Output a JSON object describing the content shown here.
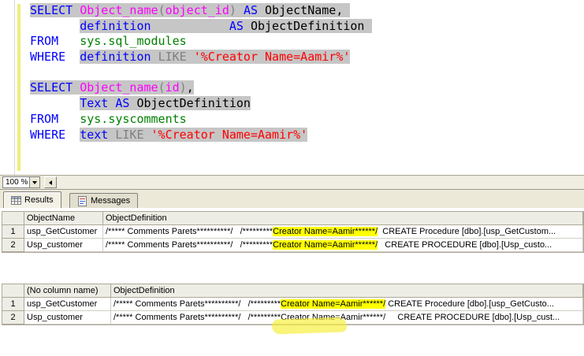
{
  "editor": {
    "lines": [
      {
        "segments": [
          {
            "t": "SELECT",
            "c": "kw",
            "hl": true
          },
          {
            "t": " ",
            "c": "pl",
            "hl": true
          },
          {
            "t": "Object_name",
            "c": "fn",
            "hl": true
          },
          {
            "t": "(",
            "c": "op",
            "hl": true
          },
          {
            "t": "object_id",
            "c": "fn",
            "hl": true
          },
          {
            "t": ")",
            "c": "op",
            "hl": true
          },
          {
            "t": " ",
            "c": "pl",
            "hl": true
          },
          {
            "t": "AS",
            "c": "kw",
            "hl": true
          },
          {
            "t": " ",
            "c": "pl",
            "hl": true
          },
          {
            "t": "ObjectName",
            "c": "pl",
            "hl": true
          },
          {
            "t": ", ",
            "c": "pl",
            "hl": true
          }
        ]
      },
      {
        "segments": [
          {
            "t": "       ",
            "c": "pl",
            "hl": false
          },
          {
            "t": "definition",
            "c": "kw",
            "hl": true
          },
          {
            "t": "           ",
            "c": "pl",
            "hl": true
          },
          {
            "t": "AS",
            "c": "kw",
            "hl": true
          },
          {
            "t": " ",
            "c": "pl",
            "hl": true
          },
          {
            "t": "ObjectDefinition",
            "c": "pl",
            "hl": true
          },
          {
            "t": " ",
            "c": "pl",
            "hl": true
          }
        ]
      },
      {
        "segments": [
          {
            "t": "FROM",
            "c": "kw",
            "hl": false
          },
          {
            "t": "   ",
            "c": "pl",
            "hl": false
          },
          {
            "t": "sys.sql_modules",
            "c": "sys",
            "hl": false
          }
        ]
      },
      {
        "segments": [
          {
            "t": "WHERE",
            "c": "kw",
            "hl": false
          },
          {
            "t": "  ",
            "c": "pl",
            "hl": false
          },
          {
            "t": "definition",
            "c": "kw",
            "hl": true
          },
          {
            "t": " ",
            "c": "pl",
            "hl": true
          },
          {
            "t": "LIKE",
            "c": "op",
            "hl": true
          },
          {
            "t": " ",
            "c": "pl",
            "hl": true
          },
          {
            "t": "'%Creator Name=Aamir%'",
            "c": "str",
            "hl": true
          }
        ]
      },
      {
        "segments": []
      },
      {
        "segments": [
          {
            "t": "SELECT",
            "c": "kw",
            "hl": true
          },
          {
            "t": " ",
            "c": "pl",
            "hl": true
          },
          {
            "t": "Object_name",
            "c": "fn",
            "hl": true
          },
          {
            "t": "(",
            "c": "op",
            "hl": true
          },
          {
            "t": "id",
            "c": "fn",
            "hl": true
          },
          {
            "t": ")",
            "c": "op",
            "hl": true
          },
          {
            "t": ",",
            "c": "pl",
            "hl": true
          }
        ]
      },
      {
        "segments": [
          {
            "t": "       ",
            "c": "pl",
            "hl": false
          },
          {
            "t": "Text",
            "c": "kw",
            "hl": true
          },
          {
            "t": " ",
            "c": "pl",
            "hl": true
          },
          {
            "t": "AS",
            "c": "kw",
            "hl": true
          },
          {
            "t": " ",
            "c": "pl",
            "hl": true
          },
          {
            "t": "ObjectDefinition",
            "c": "pl",
            "hl": true
          }
        ]
      },
      {
        "segments": [
          {
            "t": "FROM",
            "c": "kw",
            "hl": false
          },
          {
            "t": "   ",
            "c": "pl",
            "hl": false
          },
          {
            "t": "sys.syscomments",
            "c": "sys",
            "hl": false
          }
        ]
      },
      {
        "segments": [
          {
            "t": "WHERE",
            "c": "kw",
            "hl": false
          },
          {
            "t": "  ",
            "c": "pl",
            "hl": false
          },
          {
            "t": "text",
            "c": "kw",
            "hl": true
          },
          {
            "t": " ",
            "c": "pl",
            "hl": true
          },
          {
            "t": "LIKE",
            "c": "op",
            "hl": true
          },
          {
            "t": " ",
            "c": "pl",
            "hl": true
          },
          {
            "t": "'%Creator Name=Aamir%'",
            "c": "str",
            "hl": true
          }
        ]
      }
    ]
  },
  "statusbar": {
    "zoom_value": "100 %"
  },
  "results_pane": {
    "tabs": [
      {
        "label": "Results"
      },
      {
        "label": "Messages"
      }
    ],
    "grid1": {
      "columns": [
        "",
        "ObjectName",
        "ObjectDefinition"
      ],
      "rows": [
        {
          "num": "1",
          "name": "usp_GetCustomer",
          "def_pre": "/***** Comments Parets**********/   /*********",
          "def_hl": "Creator Name=Aamir******/",
          "def_post": "  CREATE Procedure [dbo].[usp_GetCustom..."
        },
        {
          "num": "2",
          "name": "Usp_customer",
          "def_pre": "/***** Comments Parets**********/   /*********",
          "def_hl": "Creator Name=Aamir******/",
          "def_post": "   CREATE PROCEDURE [dbo].[Usp_custo..."
        }
      ]
    },
    "grid2": {
      "columns": [
        "",
        "(No column name)",
        "ObjectDefinition"
      ],
      "rows": [
        {
          "num": "1",
          "name": "usp_GetCustomer",
          "def_pre": "/***** Comments Parets**********/   /*********",
          "def_hl": "Creator Name=Aamir******/",
          "def_post": " CREATE Procedure [dbo].[usp_GetCusto..."
        },
        {
          "num": "2",
          "name": "Usp_customer",
          "def_pre": "/***** Comments Parets**********/   /*********Creator Name=Aamir******/     CREATE PROCEDURE [dbo].[Usp_cust...",
          "def_hl": "",
          "def_post": ""
        }
      ]
    }
  },
  "colors": {
    "keyword": "#0000FF",
    "system_function": "#FF00FF",
    "system_object": "#008000",
    "string_literal": "#FF0000",
    "operator": "#808080",
    "selection_background": "#C6C6C6",
    "annotation_highlight": "#FFFF00",
    "change_tracking_bar": "#EDED7D"
  }
}
